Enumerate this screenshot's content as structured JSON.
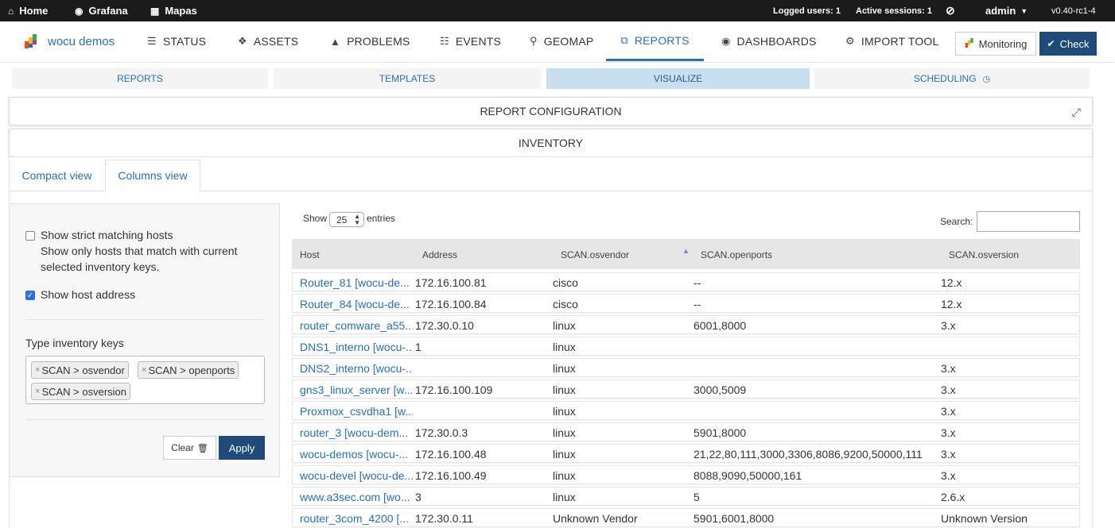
{
  "topbar": {
    "links": [
      {
        "label": "Home",
        "icon": "home-icon"
      },
      {
        "label": "Grafana",
        "icon": "dashboard-icon"
      },
      {
        "label": "Mapas",
        "icon": "map-icon"
      }
    ],
    "logged_users": "Logged users: 1",
    "active_sessions": "Active sessions: 1",
    "user": "admin",
    "version": "v0.40-rc1-4"
  },
  "nav": {
    "brand": "wocu demos",
    "items": [
      {
        "label": "STATUS",
        "icon": "list-icon"
      },
      {
        "label": "ASSETS",
        "icon": "cubes-icon"
      },
      {
        "label": "PROBLEMS",
        "icon": "warning-icon"
      },
      {
        "label": "EVENTS",
        "icon": "database-icon"
      },
      {
        "label": "GEOMAP",
        "icon": "map-marker-icon"
      },
      {
        "label": "REPORTS",
        "icon": "reports-icon"
      },
      {
        "label": "DASHBOARDS",
        "icon": "dashboard-icon"
      },
      {
        "label": "IMPORT TOOL",
        "icon": "gear-icon"
      }
    ],
    "active": "REPORTS",
    "monitoring_label": "Monitoring",
    "check_label": "Check"
  },
  "subtabs": [
    {
      "label": "REPORTS"
    },
    {
      "label": "TEMPLATES"
    },
    {
      "label": "VISUALIZE"
    },
    {
      "label": "SCHEDULING"
    }
  ],
  "panels": {
    "config_title": "REPORT CONFIGURATION",
    "inventory_title": "INVENTORY"
  },
  "views": {
    "compact": "Compact view",
    "columns": "Columns view",
    "active": "Columns view"
  },
  "filter": {
    "strict_label": "Show strict matching hosts",
    "strict_desc_1": "Show only hosts that match with current",
    "strict_desc_2": "selected inventory keys.",
    "strict_checked": false,
    "address_label": "Show host address",
    "address_checked": true,
    "keys_label": "Type inventory keys",
    "keys": [
      "SCAN > osvendor",
      "SCAN > openports",
      "SCAN > osversion"
    ],
    "clear_label": "Clear",
    "apply_label": "Apply"
  },
  "table": {
    "show_label": "Show",
    "entries_value": "25",
    "entries_label": "entries",
    "search_label": "Search:",
    "columns": [
      "Host",
      "Address",
      "SCAN.osvendor",
      "SCAN.openports",
      "SCAN.osversion"
    ],
    "sorted_column": "SCAN.osvendor",
    "rows": [
      [
        "Router_81 [wocu-de...",
        "172.16.100.81",
        "cisco",
        "--",
        "12.x"
      ],
      [
        "Router_84 [wocu-de...",
        "172.16.100.84",
        "cisco",
        "--",
        "12.x"
      ],
      [
        "router_comware_a55...",
        "172.30.0.10",
        "linux",
        "6001,8000",
        "3.x"
      ],
      [
        "DNS1_interno [wocu-...",
        "1",
        "linux",
        "",
        ""
      ],
      [
        "DNS2_interno [wocu-...",
        "",
        "linux",
        "",
        "3.x"
      ],
      [
        "gns3_linux_server [w...",
        "172.16.100.109",
        "linux",
        "3000,5009",
        "3.x"
      ],
      [
        "Proxmox_csvdha1 [w...",
        "",
        "linux",
        "",
        "3.x"
      ],
      [
        "router_3 [wocu-dem...",
        "172.30.0.3",
        "linux",
        "5901,8000",
        "3.x"
      ],
      [
        "wocu-demos [wocu-...",
        "172.16.100.48",
        "linux",
        "21,22,80,111,3000,3306,8086,9200,50000,111",
        "3.x"
      ],
      [
        "wocu-devel [wocu-de...",
        "172.16.100.49",
        "linux",
        "8088,9090,50000,161",
        "3.x"
      ],
      [
        "www.a3sec.com [wo...",
        "3",
        "linux",
        "5",
        "2.6.x"
      ],
      [
        "router_3com_4200 [...",
        "172.30.0.11",
        "Unknown Vendor",
        "5901,6001,8000",
        "Unknown Version"
      ]
    ]
  },
  "colors": {
    "accent": "#2a6fb0",
    "primary_button": "#1f4b7a",
    "active_subtab": "#c8dff2",
    "topbar": "#1b1b1b"
  }
}
